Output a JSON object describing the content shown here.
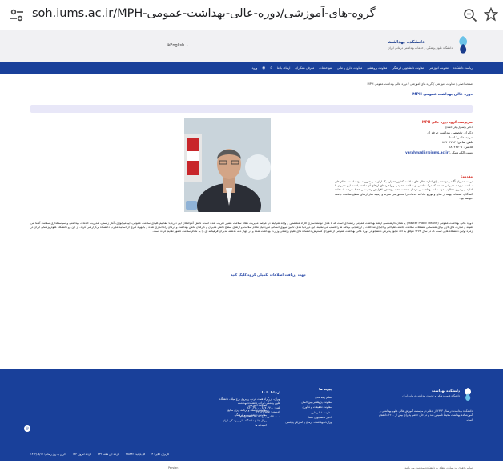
{
  "browser": {
    "url": "soh.iums.ac.ir/MPH-گروه-های-آموزشی/دوره-عالی-بهداشت-عمومی",
    "tune_icon": "tune-icon",
    "zoom_icon": "zoom-icon",
    "star_icon": "star-icon"
  },
  "header": {
    "brand_title": "دانشکده بهداشت",
    "brand_subtitle": "دانشگاه علوم پزشکی و خدمات بهداشتی درمانی ایران",
    "language": "English"
  },
  "nav": {
    "items": [
      "ریاست دانشکده",
      "معاونت آموزشی",
      "معاونت دانشجویی فرهنگی",
      "معاونت پژوهشی",
      "معاونت اداری و مالی",
      "منو خدمات",
      "معرفی همکاران",
      "ارتباط با ما",
      "ورود"
    ]
  },
  "content": {
    "breadcrumb": "صفحه اصلی / معاونت آموزشی / گروه های آموزشی / دوره عالی بهداشت عمومی MPH",
    "page_title": "دوره عالی بهداشت عمومی MPH",
    "person": {
      "heading": "سرپرست گروه دوره عالی MPH",
      "name": "دکتر رسول یاراحمدی",
      "degree": "دکترای تخصصی بهداشت حرفه ای",
      "rank": "مرتبه علمی: استاد",
      "phone": "تلفن تماس: ۸۶۷۰۴۷۸۲",
      "fax": "فاکس: ۸۸۶۲۲۷۰۷",
      "email_label": "پست الکترونیکی:",
      "email": "yarahmadi.r@iums.ac.ir"
    },
    "intro_title": "مقدمه:",
    "intro_text": "تربیت مدیران آگاه و توانمند برای اداره نظام های سلامت کشور همواره یک اولویت و ضرورت بوده است. نظام های سلامت نیازمند مدیرانی هستند که درک جامعی از سلامت عمومی و راهبردهای ارتقای آن داشته باشند. این مدیران با اداره و رهبری مطلوب موسسات بهداشت و درمان جمعیت تحت پوشش، افزایش رضایت و حفظ حرمت استفاده کنندگان، استفاده بهینه از منابع و توزیع عادلانه خدمات را محقق می سازند و زمینه ساز ارتقای سطح سلامت جامعه خواهند بود.",
    "long_text": "دوره عالی بهداشت عمومی (Master Public Health) یا همان کارشناسی ارشد بهداشت عمومی رشته ای است که با هدف توانمندسازی افراد متخصص و واجد شرایط در عرصه مدیریت نظام سلامت کشور تعریف شده است. دانش آموختگان این دوره با مفاهیم کلیدی سلامت عمومی، اپیدمیولوژی، آمار زیستی، مدیریت خدمات بهداشتی و سیاستگذاری سلامت آشنا می شوند و مهارت های لازم برای شناسایی مشکلات سلامت جامعه، طراحی و اجرای مداخلات و ارزشیابی برنامه ها را کسب می نمایند. این دوره با هدف تامین نیروی انسانی مورد نیاز نظام سلامت و ارتقای سطح دانش مدیران و کارکنان بخش بهداشت و درمان راه اندازی شده و با بهره گیری از اساتید مجرب دانشگاه برگزار می گردد. از این رو دانشگاه علوم پزشکی ایران در زمره اولین دانشگاه هایی است که در سال ۱۳۷۳ موفق به اخذ مجوز پذیرش دانشجو در دوره عالی بهداشت عمومی از شورای گسترش دانشگاه های علوم پزشکی وزارت بهداشت شده و در چهار دهه گذشته مدیران فرهیخته ای را به نظام سلامت کشور تقدیم کرده است.",
    "more_link": "جهت دریافت اطلاعات تکمیلی گروه کلیک کنید"
  },
  "footer": {
    "brand_title": "دانشکده بهداشت",
    "brand_subtitle": "دانشگاه علوم پزشکی و خدمات بهداشتی درمانی ایران",
    "brand_desc": "دانشکده بهداشت در سال ۱۳۷۳ از ادغام دو موسسه آموزش عالی علوم بهداشتی و آموزشکده بهداشت محیط تاسیس شد و در حال حاضر پذیرای بیش از ۱۲۰۰ دانشجو است.",
    "links_heading": "پیوند ها",
    "links1": [
      "نظام رتبه بندی",
      "معاونت پژوهشی بین الملل",
      "معاونت تحقیقات و فناوری",
      "معاونت غذا و دارو",
      "اخبار دانشجویی سما",
      "وزارت بهداشت، درمان و آموزش پزشکی"
    ],
    "links2": [
      "معاونت آموزشی",
      "معاونت توسعه و برنامه ریزی منابع",
      "معاونت دانشجویی و فرهنگی",
      "پرتال جامع دانشگاه علوم پزشکی ایران",
      "کتابخانه ها"
    ],
    "contact_title": "ارتباط با ما",
    "contact_lines": [
      "تهران، بزرگراه همت غرب، روبروی برج میلاد، دانشگاه",
      "علوم پزشکی ایران، دانشکده بهداشت",
      "تلفن: ۸۶۷۰۴۷۰۰ - ۸۶۷۰۴۸۰۰",
      "کدپستی: ۱۴۴۹۶۱۴۵۳۵",
      "پست الکترونیکی: sph@iums.ac.ir"
    ],
    "bottom_items": [
      "آخرین به روز رسانی: ۱۴۰۲/۰۸/۱۷",
      "بازدید امروز: ۱۶۲",
      "بازدید این هفته: ۸۳۹",
      "کل بازدید: ۲۸۵۳۴۶",
      "کاربران آنلاین: ۳"
    ]
  },
  "page_footer": {
    "copyright": "تمامی حقوق این سایت متعلق به دانشکده بهداشت می باشد",
    "language_small": "Persian"
  }
}
